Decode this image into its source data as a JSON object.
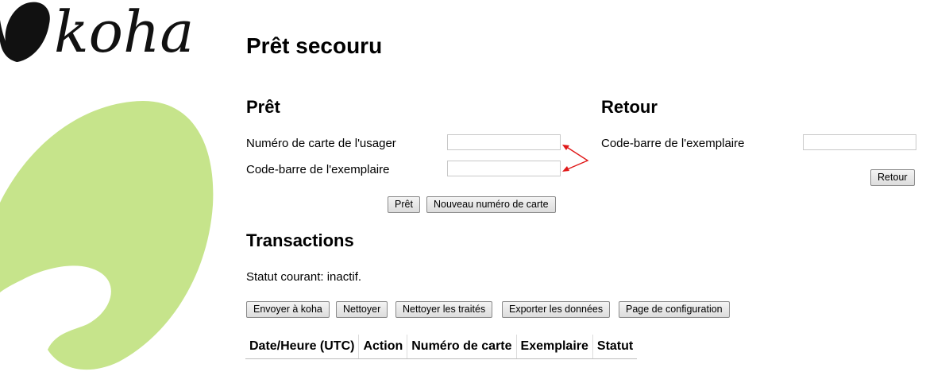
{
  "logo": {
    "text": "koha"
  },
  "page_title": "Prêt secouru",
  "checkout": {
    "title": "Prêt",
    "patron_label": "Numéro de carte de l'usager",
    "item_label": "Code-barre de l'exemplaire",
    "patron_value": "",
    "item_value": "",
    "checkout_button": "Prêt",
    "new_card_button": "Nouveau numéro de carte"
  },
  "checkin": {
    "title": "Retour",
    "item_label": "Code-barre de l'exemplaire",
    "item_value": "",
    "checkin_button": "Retour"
  },
  "transactions": {
    "title": "Transactions",
    "status_text": "Statut courant: inactif.",
    "buttons": [
      "Envoyer à koha",
      "Nettoyer",
      "Nettoyer les traités",
      "Exporter les données",
      "Page de configuration"
    ],
    "columns": [
      "Date/Heure (UTC)",
      "Action",
      "Numéro de carte",
      "Exemplaire",
      "Statut"
    ]
  },
  "colors": {
    "accent_green": "#c6e48b",
    "logo_black": "#111111",
    "arrow_red": "#e01818"
  },
  "icons": [
    "koha-logo-icon",
    "annotation-arrow-icon"
  ]
}
